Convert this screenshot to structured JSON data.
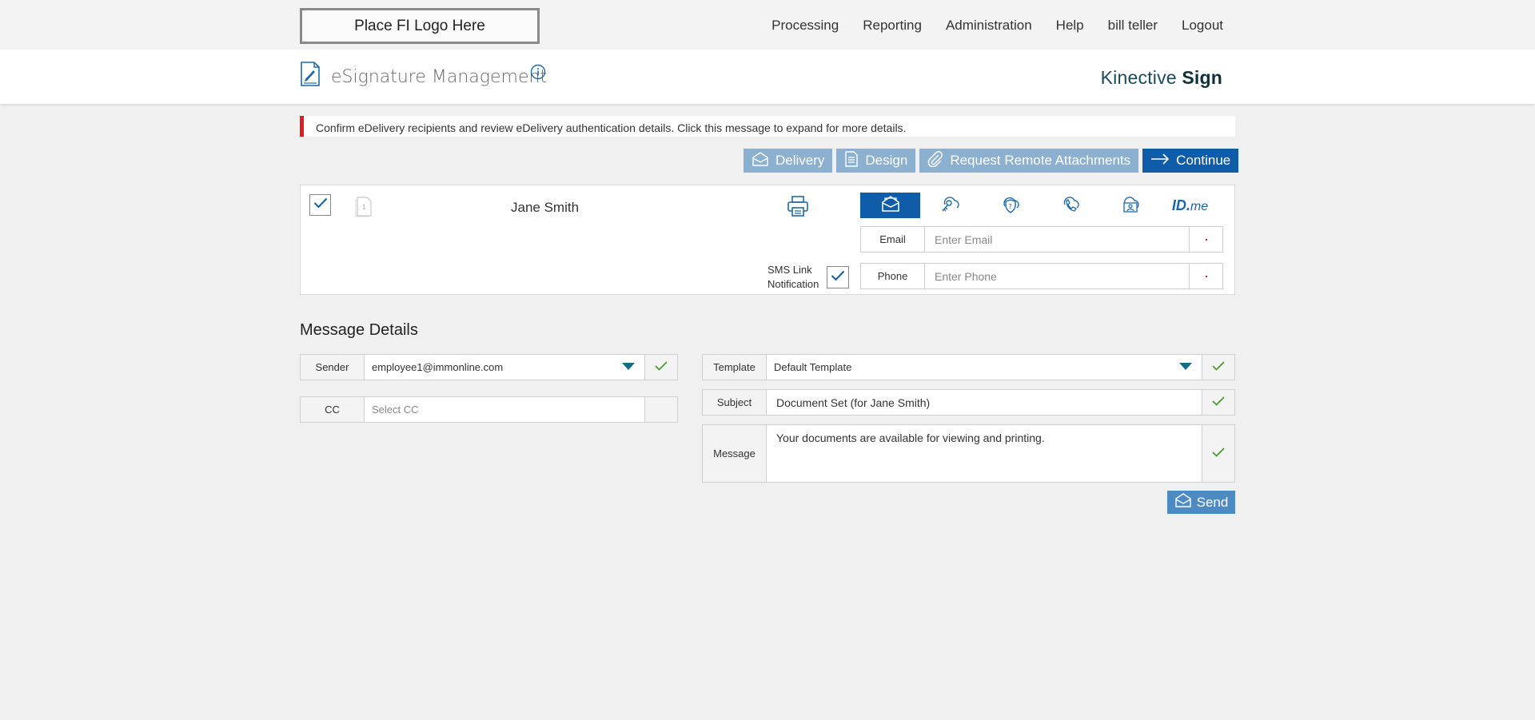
{
  "header": {
    "logo_text": "Place FI Logo Here",
    "nav": [
      "Processing",
      "Reporting",
      "Administration",
      "Help",
      "bill teller",
      "Logout"
    ]
  },
  "titlebar": {
    "title": "eSignature Management",
    "brand_light": "Kinective ",
    "brand_bold": "Sign"
  },
  "alert": {
    "text": "Confirm eDelivery recipients and review eDelivery authentication details. Click this message to expand for more details.",
    "color": "#e21b1b"
  },
  "actions": {
    "delivery": "Delivery",
    "design": "Design",
    "attachments": "Request Remote Attachments",
    "continue": "Continue"
  },
  "recipient": {
    "checked": true,
    "doc_number": "1",
    "name": "Jane Smith",
    "sms_label_line1": "SMS Link",
    "sms_label_line2": "Notification",
    "sms_checked": true,
    "auth_methods": [
      "email-icon",
      "key-icon",
      "security-question-icon",
      "phone-icon",
      "id-card-icon",
      "idme-logo"
    ],
    "idme_bold": "ID.",
    "idme_italic": "me",
    "email_label": "Email",
    "email_placeholder": "Enter Email",
    "phone_label": "Phone",
    "phone_placeholder": "Enter Phone"
  },
  "message_details": {
    "title": "Message Details",
    "sender_label": "Sender",
    "sender_value": "employee1@immonline.com",
    "cc_label": "CC",
    "cc_placeholder": "Select CC",
    "template_label": "Template",
    "template_value": "Default Template",
    "subject_label": "Subject",
    "subject_value": "Document Set (for Jane Smith)",
    "message_label": "Message",
    "message_value": "Your documents are available for viewing and printing.",
    "send_label": "Send"
  },
  "colors": {
    "primary": "#0f5da8",
    "muted_button": "#8cb0cf",
    "send_button": "#4d8ac2",
    "check_green": "#4a9a2e",
    "caret_teal": "#136b85"
  }
}
